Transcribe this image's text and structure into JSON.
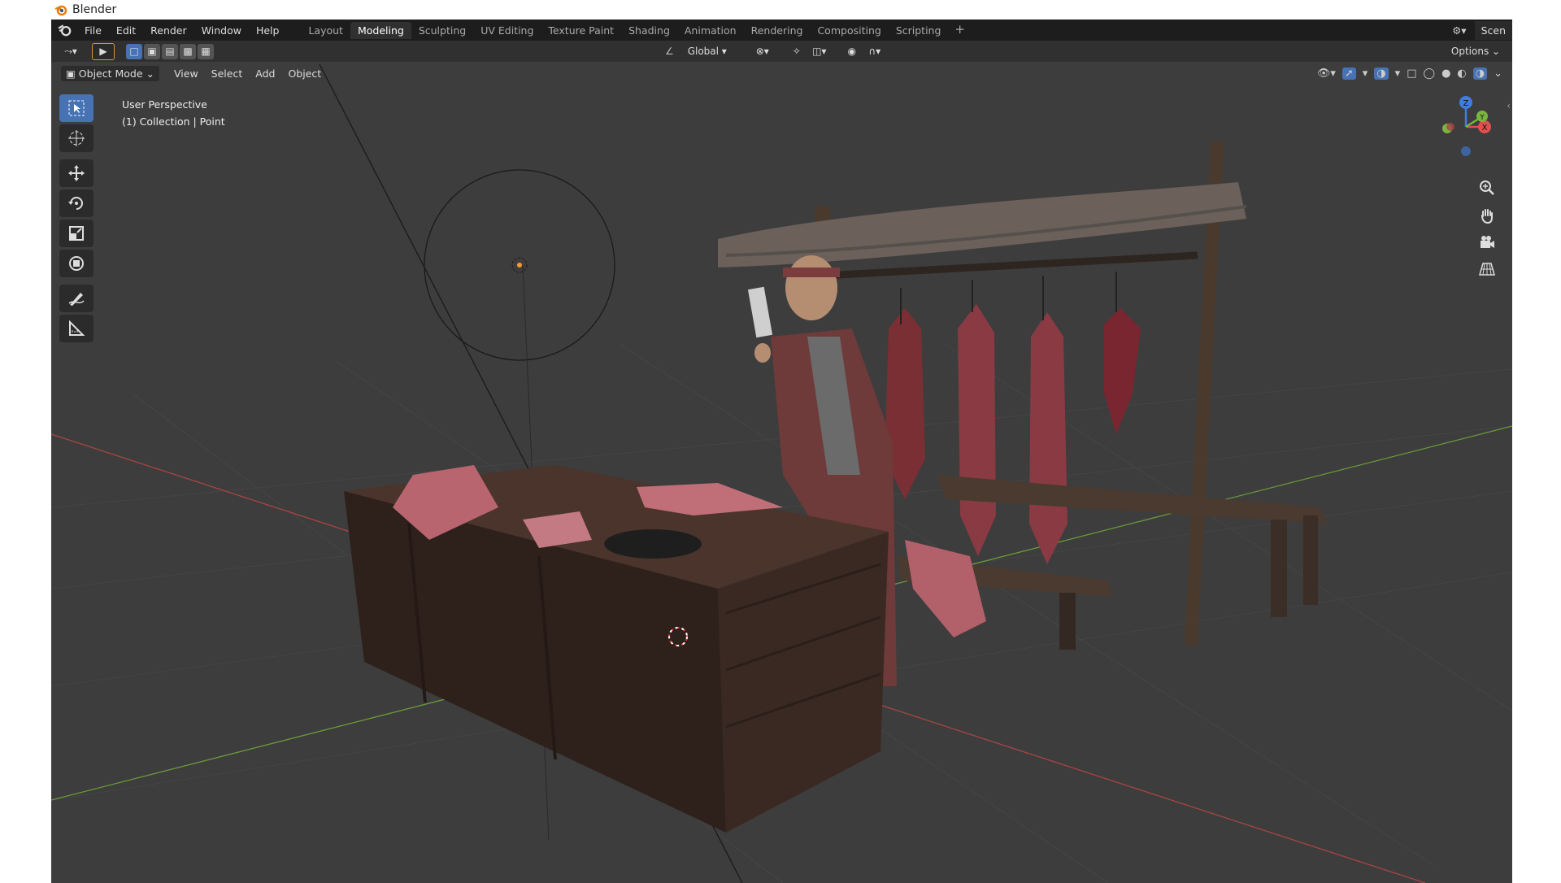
{
  "window": {
    "title": "Blender"
  },
  "topbar": {
    "menu": [
      "File",
      "Edit",
      "Render",
      "Window",
      "Help"
    ],
    "workspaces": [
      "Layout",
      "Modeling",
      "Sculpting",
      "UV Editing",
      "Texture Paint",
      "Shading",
      "Animation",
      "Rendering",
      "Compositing",
      "Scripting"
    ],
    "active_workspace": "Modeling",
    "add_tab": "+",
    "scene_label": "Scen"
  },
  "header": {
    "transform_orientation": "Global",
    "options_label": "Options"
  },
  "viewport_header": {
    "mode": "Object Mode",
    "menus": [
      "View",
      "Select",
      "Add",
      "Object"
    ]
  },
  "overlay": {
    "perspective": "User Perspective",
    "collection": "(1) Collection | Point"
  },
  "gizmo": {
    "z": "Z",
    "y": "Y",
    "x": "X"
  },
  "colors": {
    "background": "#3d3d3d",
    "active_tool": "#4772b3",
    "x_axis": "#a84545",
    "y_axis": "#6a9a3a",
    "gizmo_x": "#e0504f",
    "gizmo_y": "#7ab63f",
    "gizmo_z": "#3e7ee0"
  }
}
